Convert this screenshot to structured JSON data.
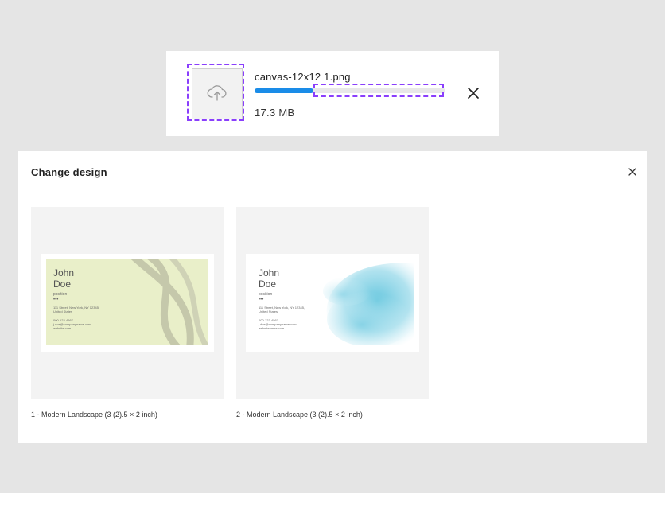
{
  "upload": {
    "file_name": "canvas-12x12 1.png",
    "file_size": "17.3 MB",
    "progress": 0.31,
    "thumb_icon": "cloud-upload-icon",
    "close_icon": "close-icon"
  },
  "change_design": {
    "title": "Change design",
    "close_icon": "close-icon",
    "designs": [
      {
        "caption": "1 - Modern Landscape (3 (2).5 × 2 inch)",
        "first_name": "John",
        "last_name": "Doe",
        "position": "position",
        "dots": "•••",
        "address_line1": "111 Street, New York, NY 12345,",
        "address_line2": "United States",
        "phone": "000-123-4567",
        "email": "j.doe@companyname.com",
        "website": "website.com",
        "background": "#e9efc9",
        "decoration": "swirl-lines"
      },
      {
        "caption": "2 - Modern Landscape (3 (2).5 × 2 inch)",
        "first_name": "John",
        "last_name": "Doe",
        "position": "position",
        "dots": "•••",
        "address_line1": "111 Street, New York, NY 12345,",
        "address_line2": "United States",
        "phone": "000-123-4567",
        "email": "j.doe@companyname.com",
        "website": "websitename.com",
        "background": "#ffffff",
        "decoration": "watercolor-blue"
      }
    ]
  },
  "colors": {
    "accent": "#1a8ce8",
    "selection_outline": "#8a3ffc",
    "canvas_background": "#e5e5e5"
  }
}
